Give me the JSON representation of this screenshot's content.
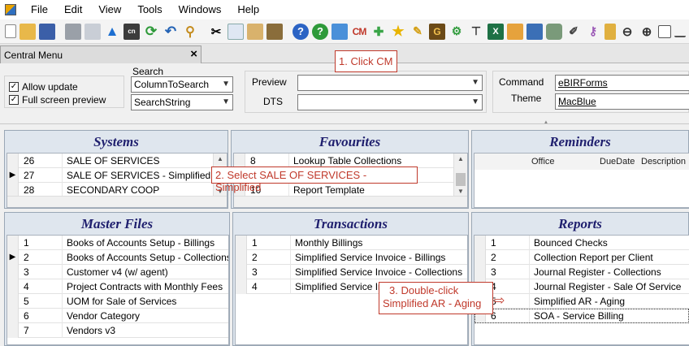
{
  "menu": {
    "items": [
      "File",
      "Edit",
      "View",
      "Tools",
      "Windows",
      "Help"
    ]
  },
  "tab": {
    "title": "Central Menu",
    "close": "×"
  },
  "options": {
    "allow_update": "Allow update",
    "full_screen": "Full screen preview"
  },
  "search": {
    "label": "Search",
    "column": "ColumnToSearch",
    "string": "SearchString"
  },
  "preview": {
    "label": "Preview",
    "dts_label": "DTS",
    "value": "",
    "dts_value": ""
  },
  "command": {
    "label": "Command",
    "value": "eBIRForms",
    "theme_label": "Theme",
    "theme_value": "MacBlue"
  },
  "systems": {
    "title": "Systems",
    "rows": [
      {
        "id": "26",
        "name": "SALE OF SERVICES"
      },
      {
        "id": "27",
        "name": "SALE OF SERVICES - Simplified"
      },
      {
        "id": "28",
        "name": "SECONDARY COOP"
      }
    ]
  },
  "favourites": {
    "title": "Favourites",
    "rows": [
      {
        "id": "8",
        "name": "Lookup Table Collections"
      },
      {
        "id": "9",
        "name": ""
      },
      {
        "id": "10",
        "name": "Report Template"
      }
    ]
  },
  "reminders": {
    "title": "Reminders",
    "col_office": "Office",
    "col_duedate": "DueDate",
    "col_description": "Description"
  },
  "master_files": {
    "title": "Master Files",
    "rows": [
      {
        "id": "1",
        "name": "Books  of Accounts Setup - Billings"
      },
      {
        "id": "2",
        "name": "Books of Accounts Setup - Collections"
      },
      {
        "id": "3",
        "name": "Customer v4 (w/ agent)"
      },
      {
        "id": "4",
        "name": "Project Contracts with Monthly Fees"
      },
      {
        "id": "5",
        "name": "UOM for Sale of Services"
      },
      {
        "id": "6",
        "name": "Vendor Category"
      },
      {
        "id": "7",
        "name": "Vendors v3"
      }
    ]
  },
  "transactions": {
    "title": "Transactions",
    "rows": [
      {
        "id": "1",
        "name": "Monthly Billings"
      },
      {
        "id": "2",
        "name": "Simplified Service Invoice - Billings"
      },
      {
        "id": "3",
        "name": "Simplified Service Invoice - Collections"
      },
      {
        "id": "4",
        "name": "Simplified Service Invoice - Billings &amp; Collections"
      }
    ]
  },
  "reports": {
    "title": "Reports",
    "rows": [
      {
        "id": "1",
        "name": "Bounced Checks"
      },
      {
        "id": "2",
        "name": "Collection Report per Client"
      },
      {
        "id": "3",
        "name": "Journal Register - Collections"
      },
      {
        "id": "4",
        "name": "Journal Register - Sale Of Service"
      },
      {
        "id": "5",
        "name": "Simplified AR - Aging"
      },
      {
        "id": "6",
        "name": "SOA - Service Billing"
      }
    ]
  },
  "callouts": {
    "step1": "1. Click CM",
    "step2": "2. Select SALE OF SERVICES - Simplified",
    "step3_line1": "3. Double-click",
    "step3_line2": "Simplified AR - Aging"
  },
  "colors": {
    "panel_title": "#1f1f6e",
    "callout": "#c0392b",
    "panel_bg": "#dfe6ee"
  }
}
